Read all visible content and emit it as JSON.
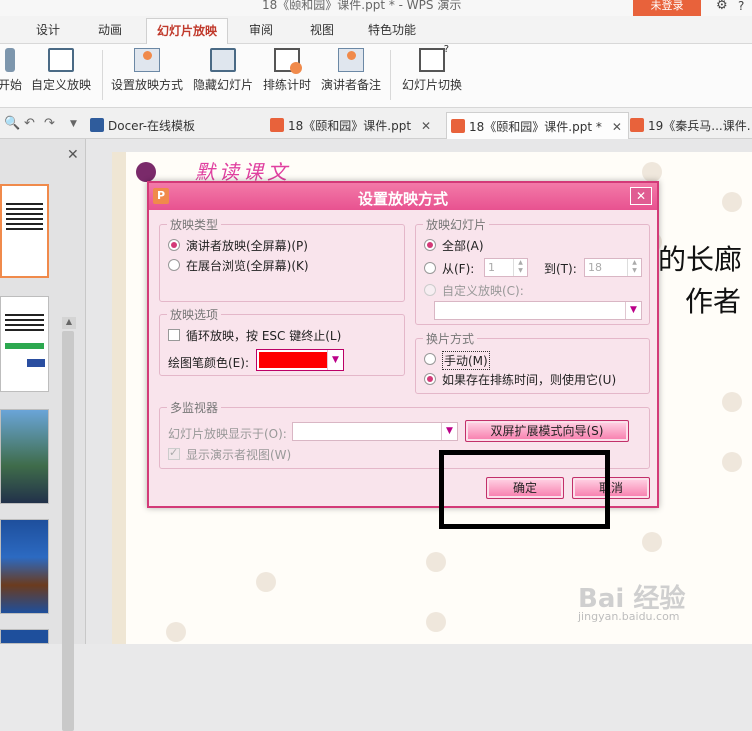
{
  "window": {
    "title": "18《颐和园》课件.ppt * - WPS 演示",
    "login_label": "未登录",
    "settings_icon": "gear-icon",
    "help_icon": "question-icon"
  },
  "menu_tabs": [
    "设计",
    "动画",
    "幻灯片放映",
    "审阅",
    "视图",
    "特色功能"
  ],
  "active_tab": "幻灯片放映",
  "ribbon": {
    "items": [
      "开始",
      "自定义放映",
      "设置放映方式",
      "隐藏幻灯片",
      "排练计时",
      "演讲者备注",
      "幻灯片切换"
    ]
  },
  "doc_tabs": [
    {
      "label": "Docer-在线模板",
      "close": ""
    },
    {
      "label": "18《颐和园》课件.ppt",
      "close": "✕"
    },
    {
      "label": "18《颐和园》课件.ppt *",
      "close": "✕"
    },
    {
      "label": "19《秦兵马...课件.",
      "close": ""
    }
  ],
  "left_panel": {
    "close_glyph": "✕"
  },
  "slide": {
    "title_art": "默读课文",
    "text_line_1": "的长廊",
    "text_line_2": "作者"
  },
  "watermark": {
    "brand": "Bai 经验",
    "sub": "jingyan.baidu.com"
  },
  "dialog": {
    "title": "设置放映方式",
    "app_icon_letter": "P",
    "close_glyph": "✕",
    "show_type": {
      "title": "放映类型",
      "options": [
        "演讲者放映(全屏幕)(P)",
        "在展台浏览(全屏幕)(K)"
      ],
      "selected": 0
    },
    "show_slides": {
      "title": "放映幻灯片",
      "all_label": "全部(A)",
      "from_label": "从(F):",
      "from_value": "1",
      "to_label": "到(T):",
      "to_value": "18",
      "custom_label": "自定义放映(C):",
      "selected": "all"
    },
    "show_options": {
      "title": "放映选项",
      "loop_label": "循环放映，按 ESC 键终止(L)",
      "pen_color_label": "绘图笔颜色(E):",
      "pen_color": "#ff0000"
    },
    "advance": {
      "title": "换片方式",
      "manual_label": "手动(M)",
      "timing_label": "如果存在排练时间，则使用它(U)",
      "selected": "timing"
    },
    "monitors": {
      "title": "多监视器",
      "display_on_label": "幻灯片放映显示于(O):",
      "presenter_view_label": "显示演示者视图(W)",
      "wizard_button": "双屏扩展模式向导(S)"
    },
    "ok_button": "确定",
    "cancel_button": "取消"
  },
  "colors": {
    "accent": "#d33a78",
    "dialog_bg": "#f9e4ec",
    "brand_orange": "#e8623b"
  }
}
